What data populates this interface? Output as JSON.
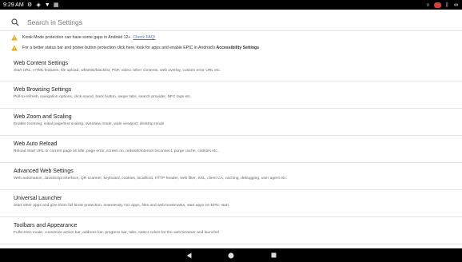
{
  "status_bar": {
    "time": "9:29 AM",
    "left_icons": [
      "settings-icon",
      "shield-icon",
      "notification-icon",
      "grid-icon"
    ],
    "right_icons": [
      "headset-icon",
      "recording-badge",
      "bluetooth-icon",
      "link-icon"
    ],
    "badge_color": "#e53935"
  },
  "search": {
    "placeholder": "Search in Settings"
  },
  "notices": [
    {
      "text": "Kiosk Mode protection can have some gaps in Android 12+",
      "link": "Check FAQ!",
      "icon_color": "#f0a500"
    },
    {
      "text": "For a better status bar and power button protection click here, look for apps and enable EPIC in Android's",
      "bold": "Accessibility Settings",
      "icon_color": "#f0a500"
    }
  ],
  "settings_items": [
    {
      "title": "Web Content Settings",
      "subtitle": "Start URL, HTML features, file upload, whitelist/blacklist, PDF, video, other contents, web overlay, custom error URL etc."
    },
    {
      "title": "Web Browsing Settings",
      "subtitle": "Pull-to-refresh, navigation options, click sound, back button, swipe tabs, search provider, NFC tags etc."
    },
    {
      "title": "Web Zoom and Scaling",
      "subtitle": "Enable zooming, initial page/text scaling, overview mode, wide viewport, desktop mode"
    },
    {
      "title": "Web Auto Reload",
      "subtitle": "Reload Start URL or current page on idle, page error, screen on, network/internet reconnect, purge cache, cookies etc."
    },
    {
      "title": "Advanced Web Settings",
      "subtitle": "Web automation, JavaScript interface, QR scanner, keyboard, cookies, localhost, HTTP header, web filter, SSL, client CA, caching, debugging, user agent etc."
    },
    {
      "title": "Universal Launcher",
      "subtitle": "Start other apps and give them full kiosk protection, seamlessly mix apps, files and web bookmarks, start apps on EPIC start."
    },
    {
      "title": "Toolbars and Appearance",
      "subtitle": "Fullscreen mode, customize action bar, address bar, progress bar, tabs, select colors for the web browser and launcher"
    }
  ],
  "nav_bar": {
    "buttons": [
      "back-icon",
      "home-icon",
      "recents-icon"
    ]
  }
}
